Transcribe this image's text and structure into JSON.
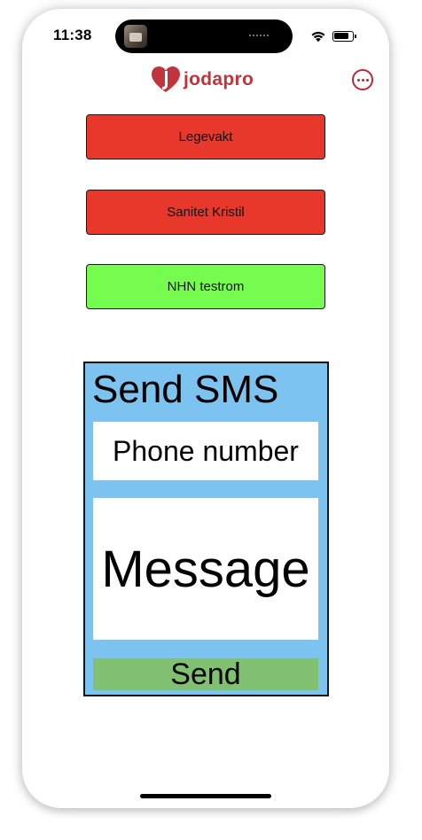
{
  "status_bar": {
    "time": "11:38",
    "wifi_icon": "wifi-icon",
    "battery_icon": "battery-icon"
  },
  "header": {
    "logo_text": "jodapro",
    "brand_color": "#c0343b",
    "more_icon": "more-options-icon"
  },
  "rooms": [
    {
      "label": "Legevakt",
      "color": "#e8372b"
    },
    {
      "label": "Sanitet Kristil",
      "color": "#e8372b"
    },
    {
      "label": "NHN testrom",
      "color": "#76fc4f"
    }
  ],
  "sms": {
    "title": "Send SMS",
    "phone_placeholder": "Phone number",
    "message_placeholder": "Message",
    "send_label": "Send",
    "panel_color": "#7cc3f0",
    "send_color": "#7fc170"
  }
}
